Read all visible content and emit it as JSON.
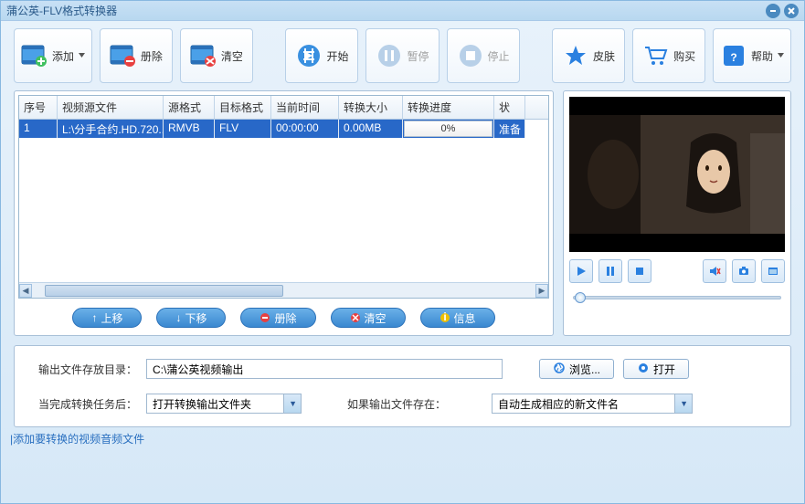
{
  "window": {
    "title": "蒲公英-FLV格式转换器"
  },
  "toolbar": {
    "add": "添加",
    "remove": "册除",
    "clear": "清空",
    "start": "开始",
    "pause": "暂停",
    "stop": "停止",
    "skin": "皮肤",
    "buy": "购买",
    "help": "帮助"
  },
  "table": {
    "headers": {
      "index": "序号",
      "source": "视频源文件",
      "src_fmt": "源格式",
      "dst_fmt": "目标格式",
      "time": "当前时间",
      "size": "转换大小",
      "progress": "转换进度",
      "status": "状"
    },
    "rows": [
      {
        "index": "1",
        "source": "L:\\分手合约.HD.720...",
        "src_fmt": "RMVB",
        "dst_fmt": "FLV",
        "time": "00:00:00",
        "size": "0.00MB",
        "progress": "0%",
        "status": "准备"
      }
    ]
  },
  "list_buttons": {
    "up": "上移",
    "down": "下移",
    "delete": "册除",
    "clear": "清空",
    "info": "信息"
  },
  "output": {
    "dir_label": "输出文件存放目录：",
    "dir_value": "C:\\蒲公英视频输出",
    "browse": "浏览...",
    "open": "打开",
    "after_label": "当完成转换任务后：",
    "after_value": "打开转换输出文件夹",
    "exists_label": "如果输出文件存在：",
    "exists_value": "自动生成相应的新文件名"
  },
  "status_bar": "添加要转换的视频音频文件"
}
